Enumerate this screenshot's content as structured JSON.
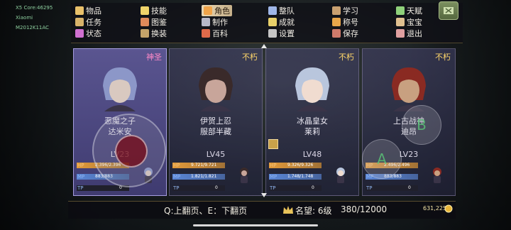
{
  "device": {
    "lines": [
      "X5 Core:46295",
      "Xiaomi",
      "M2012K11AC"
    ]
  },
  "menu": [
    {
      "label": "物品",
      "icon": "bag-icon",
      "color": "#e9c06a",
      "active": false
    },
    {
      "label": "技能",
      "icon": "moon-icon",
      "color": "#f0d36a",
      "active": false
    },
    {
      "label": "角色",
      "icon": "character-icon",
      "color": "#f0a44a",
      "active": true
    },
    {
      "label": "整队",
      "icon": "team-icon",
      "color": "#9fb6e8",
      "active": false
    },
    {
      "label": "学习",
      "icon": "scroll-icon",
      "color": "#c9a070",
      "active": false
    },
    {
      "label": "天赋",
      "icon": "talent-icon",
      "color": "#8fd07a",
      "active": false
    },
    {
      "label": "任务",
      "icon": "quest-icon",
      "color": "#d8b26a",
      "active": false
    },
    {
      "label": "图鉴",
      "icon": "codex-icon",
      "color": "#e08a5a",
      "active": false
    },
    {
      "label": "制作",
      "icon": "anvil-icon",
      "color": "#b8b8c8",
      "active": false
    },
    {
      "label": "成就",
      "icon": "trophy-icon",
      "color": "#e8d06a",
      "active": false
    },
    {
      "label": "称号",
      "icon": "title-icon",
      "color": "#e8a64a",
      "active": false
    },
    {
      "label": "宝宝",
      "icon": "pet-icon",
      "color": "#e0c090",
      "active": false
    },
    {
      "label": "状态",
      "icon": "status-icon",
      "color": "#d070d0",
      "active": false
    },
    {
      "label": "换装",
      "icon": "outfit-icon",
      "color": "#c4a36a",
      "active": false
    },
    {
      "label": "百科",
      "icon": "encyclopedia-icon",
      "color": "#e06a4a",
      "active": false
    },
    {
      "label": "设置",
      "icon": "settings-icon",
      "color": "#c6c6c6",
      "active": false
    },
    {
      "label": "保存",
      "icon": "save-icon",
      "color": "#d07a6a",
      "active": false
    },
    {
      "label": "退出",
      "icon": "exit-icon",
      "color": "#e0a0a0",
      "active": false
    }
  ],
  "characters": [
    {
      "rank": "神圣",
      "name1": "恶魔之子",
      "name2": "达米安",
      "level": "LV23",
      "hp": "2.396/2.396",
      "mp": "883/883",
      "tp": "0",
      "hp_fraction": 1.0,
      "mp_fraction": 1.0,
      "hair": "#8c97c8",
      "skin": "#d9c9c0",
      "rank_type": "divine",
      "selected": true
    },
    {
      "rank": "不朽",
      "name1": "伊贺上忍",
      "name2": "服部半藏",
      "level": "LV45",
      "hp": "9.721/9.721",
      "mp": "1.821/1.821",
      "tp": "0",
      "hp_fraction": 1.0,
      "mp_fraction": 1.0,
      "hair": "#3a2a2a",
      "skin": "#c8a59a",
      "rank_type": "immortal",
      "selected": false
    },
    {
      "rank": "不朽",
      "name1": "冰晶皇女",
      "name2": "莱莉",
      "level": "LV48",
      "hp": "9.326/9.326",
      "mp": "1.748/1.748",
      "tp": "0",
      "hp_fraction": 1.0,
      "mp_fraction": 1.0,
      "hair": "#b9c6dd",
      "skin": "#f0dcd0",
      "rank_type": "immortal",
      "selected": false
    },
    {
      "rank": "不朽",
      "name1": "上古战神",
      "name2": "迪昂",
      "level": "LV23",
      "hp": "2.496/2.496",
      "mp": "883/883",
      "tp": "0",
      "hp_fraction": 1.0,
      "mp_fraction": 1.0,
      "hair": "#8a2a22",
      "skin": "#c8a080",
      "rank_type": "immortal",
      "selected": false
    }
  ],
  "labels": {
    "hp": "HP",
    "mp": "MP",
    "tp": "TP"
  },
  "footer": {
    "page_hint": "Q:上翻页、E：下翻页",
    "fame_label": "名望: 6级",
    "fame_progress": "380/12000",
    "gold": "631,225"
  },
  "controls": {
    "button_b": "B",
    "button_a": "A"
  },
  "colors": {
    "hp": "#e29a3a",
    "mp": "#5a86d6",
    "tp": "#3a6ab8",
    "rank": "#ffd76a",
    "divine": "#ff8ac9",
    "menu_active": "#e9d7b3"
  }
}
